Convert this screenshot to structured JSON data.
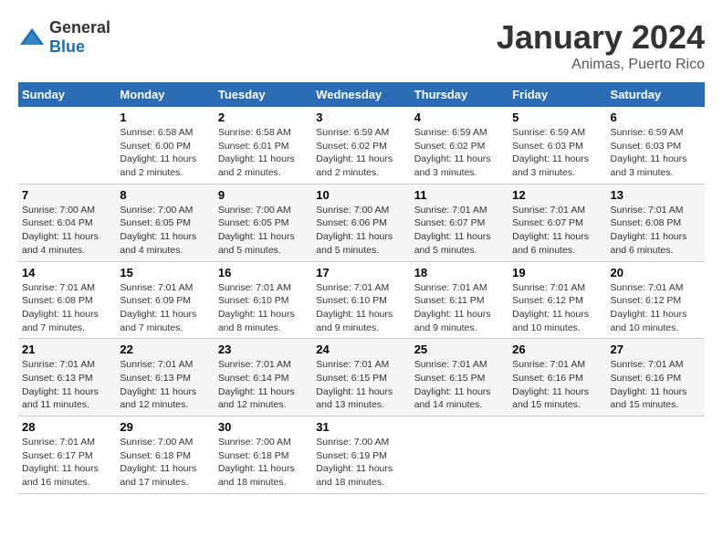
{
  "logo": {
    "general": "General",
    "blue": "Blue"
  },
  "title": "January 2024",
  "location": "Animas, Puerto Rico",
  "weekdays": [
    "Sunday",
    "Monday",
    "Tuesday",
    "Wednesday",
    "Thursday",
    "Friday",
    "Saturday"
  ],
  "weeks": [
    [
      {
        "day": "",
        "info": ""
      },
      {
        "day": "1",
        "info": "Sunrise: 6:58 AM\nSunset: 6:00 PM\nDaylight: 11 hours\nand 2 minutes."
      },
      {
        "day": "2",
        "info": "Sunrise: 6:58 AM\nSunset: 6:01 PM\nDaylight: 11 hours\nand 2 minutes."
      },
      {
        "day": "3",
        "info": "Sunrise: 6:59 AM\nSunset: 6:02 PM\nDaylight: 11 hours\nand 2 minutes."
      },
      {
        "day": "4",
        "info": "Sunrise: 6:59 AM\nSunset: 6:02 PM\nDaylight: 11 hours\nand 3 minutes."
      },
      {
        "day": "5",
        "info": "Sunrise: 6:59 AM\nSunset: 6:03 PM\nDaylight: 11 hours\nand 3 minutes."
      },
      {
        "day": "6",
        "info": "Sunrise: 6:59 AM\nSunset: 6:03 PM\nDaylight: 11 hours\nand 3 minutes."
      }
    ],
    [
      {
        "day": "7",
        "info": "Sunrise: 7:00 AM\nSunset: 6:04 PM\nDaylight: 11 hours\nand 4 minutes."
      },
      {
        "day": "8",
        "info": "Sunrise: 7:00 AM\nSunset: 6:05 PM\nDaylight: 11 hours\nand 4 minutes."
      },
      {
        "day": "9",
        "info": "Sunrise: 7:00 AM\nSunset: 6:05 PM\nDaylight: 11 hours\nand 5 minutes."
      },
      {
        "day": "10",
        "info": "Sunrise: 7:00 AM\nSunset: 6:06 PM\nDaylight: 11 hours\nand 5 minutes."
      },
      {
        "day": "11",
        "info": "Sunrise: 7:01 AM\nSunset: 6:07 PM\nDaylight: 11 hours\nand 5 minutes."
      },
      {
        "day": "12",
        "info": "Sunrise: 7:01 AM\nSunset: 6:07 PM\nDaylight: 11 hours\nand 6 minutes."
      },
      {
        "day": "13",
        "info": "Sunrise: 7:01 AM\nSunset: 6:08 PM\nDaylight: 11 hours\nand 6 minutes."
      }
    ],
    [
      {
        "day": "14",
        "info": "Sunrise: 7:01 AM\nSunset: 6:08 PM\nDaylight: 11 hours\nand 7 minutes."
      },
      {
        "day": "15",
        "info": "Sunrise: 7:01 AM\nSunset: 6:09 PM\nDaylight: 11 hours\nand 7 minutes."
      },
      {
        "day": "16",
        "info": "Sunrise: 7:01 AM\nSunset: 6:10 PM\nDaylight: 11 hours\nand 8 minutes."
      },
      {
        "day": "17",
        "info": "Sunrise: 7:01 AM\nSunset: 6:10 PM\nDaylight: 11 hours\nand 9 minutes."
      },
      {
        "day": "18",
        "info": "Sunrise: 7:01 AM\nSunset: 6:11 PM\nDaylight: 11 hours\nand 9 minutes."
      },
      {
        "day": "19",
        "info": "Sunrise: 7:01 AM\nSunset: 6:12 PM\nDaylight: 11 hours\nand 10 minutes."
      },
      {
        "day": "20",
        "info": "Sunrise: 7:01 AM\nSunset: 6:12 PM\nDaylight: 11 hours\nand 10 minutes."
      }
    ],
    [
      {
        "day": "21",
        "info": "Sunrise: 7:01 AM\nSunset: 6:13 PM\nDaylight: 11 hours\nand 11 minutes."
      },
      {
        "day": "22",
        "info": "Sunrise: 7:01 AM\nSunset: 6:13 PM\nDaylight: 11 hours\nand 12 minutes."
      },
      {
        "day": "23",
        "info": "Sunrise: 7:01 AM\nSunset: 6:14 PM\nDaylight: 11 hours\nand 12 minutes."
      },
      {
        "day": "24",
        "info": "Sunrise: 7:01 AM\nSunset: 6:15 PM\nDaylight: 11 hours\nand 13 minutes."
      },
      {
        "day": "25",
        "info": "Sunrise: 7:01 AM\nSunset: 6:15 PM\nDaylight: 11 hours\nand 14 minutes."
      },
      {
        "day": "26",
        "info": "Sunrise: 7:01 AM\nSunset: 6:16 PM\nDaylight: 11 hours\nand 15 minutes."
      },
      {
        "day": "27",
        "info": "Sunrise: 7:01 AM\nSunset: 6:16 PM\nDaylight: 11 hours\nand 15 minutes."
      }
    ],
    [
      {
        "day": "28",
        "info": "Sunrise: 7:01 AM\nSunset: 6:17 PM\nDaylight: 11 hours\nand 16 minutes."
      },
      {
        "day": "29",
        "info": "Sunrise: 7:00 AM\nSunset: 6:18 PM\nDaylight: 11 hours\nand 17 minutes."
      },
      {
        "day": "30",
        "info": "Sunrise: 7:00 AM\nSunset: 6:18 PM\nDaylight: 11 hours\nand 18 minutes."
      },
      {
        "day": "31",
        "info": "Sunrise: 7:00 AM\nSunset: 6:19 PM\nDaylight: 11 hours\nand 18 minutes."
      },
      {
        "day": "",
        "info": ""
      },
      {
        "day": "",
        "info": ""
      },
      {
        "day": "",
        "info": ""
      }
    ]
  ]
}
